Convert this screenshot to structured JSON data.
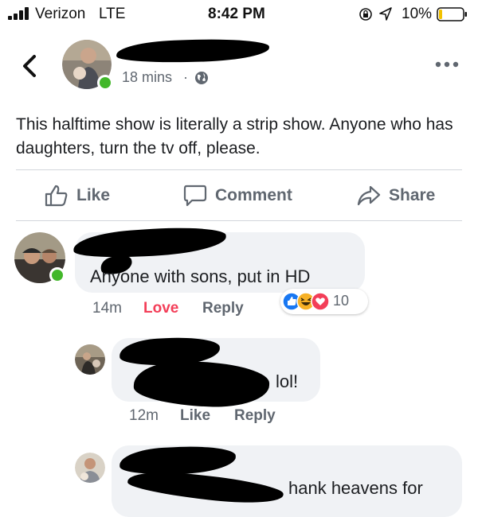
{
  "status_bar": {
    "carrier": "Verizon",
    "network": "LTE",
    "time": "8:42 PM",
    "battery": "10%",
    "battery_fraction": 0.1
  },
  "post": {
    "timestamp": "18 mins",
    "separator": "·",
    "privacy_icon": "globe-icon",
    "text": "This halftime show is literally a strip show. Anyone who has daughters, turn the tv off, please."
  },
  "actions": {
    "like": "Like",
    "comment": "Comment",
    "share": "Share"
  },
  "comments": [
    {
      "text": "Anyone with sons, put in HD",
      "time": "14m",
      "reaction_label": "Love",
      "reply": "Reply",
      "reaction_count": "10",
      "reaction_icons": [
        "like-reaction-icon",
        "haha-reaction-icon",
        "love-reaction-icon"
      ]
    },
    {
      "text": "lol!",
      "time": "12m",
      "like": "Like",
      "reply": "Reply"
    },
    {
      "text": "hank heavens for"
    }
  ],
  "colors": {
    "love": "#f33e58",
    "online": "#42b72a",
    "like_blue": "#1877f2",
    "haha_yellow": "#f7b125"
  }
}
